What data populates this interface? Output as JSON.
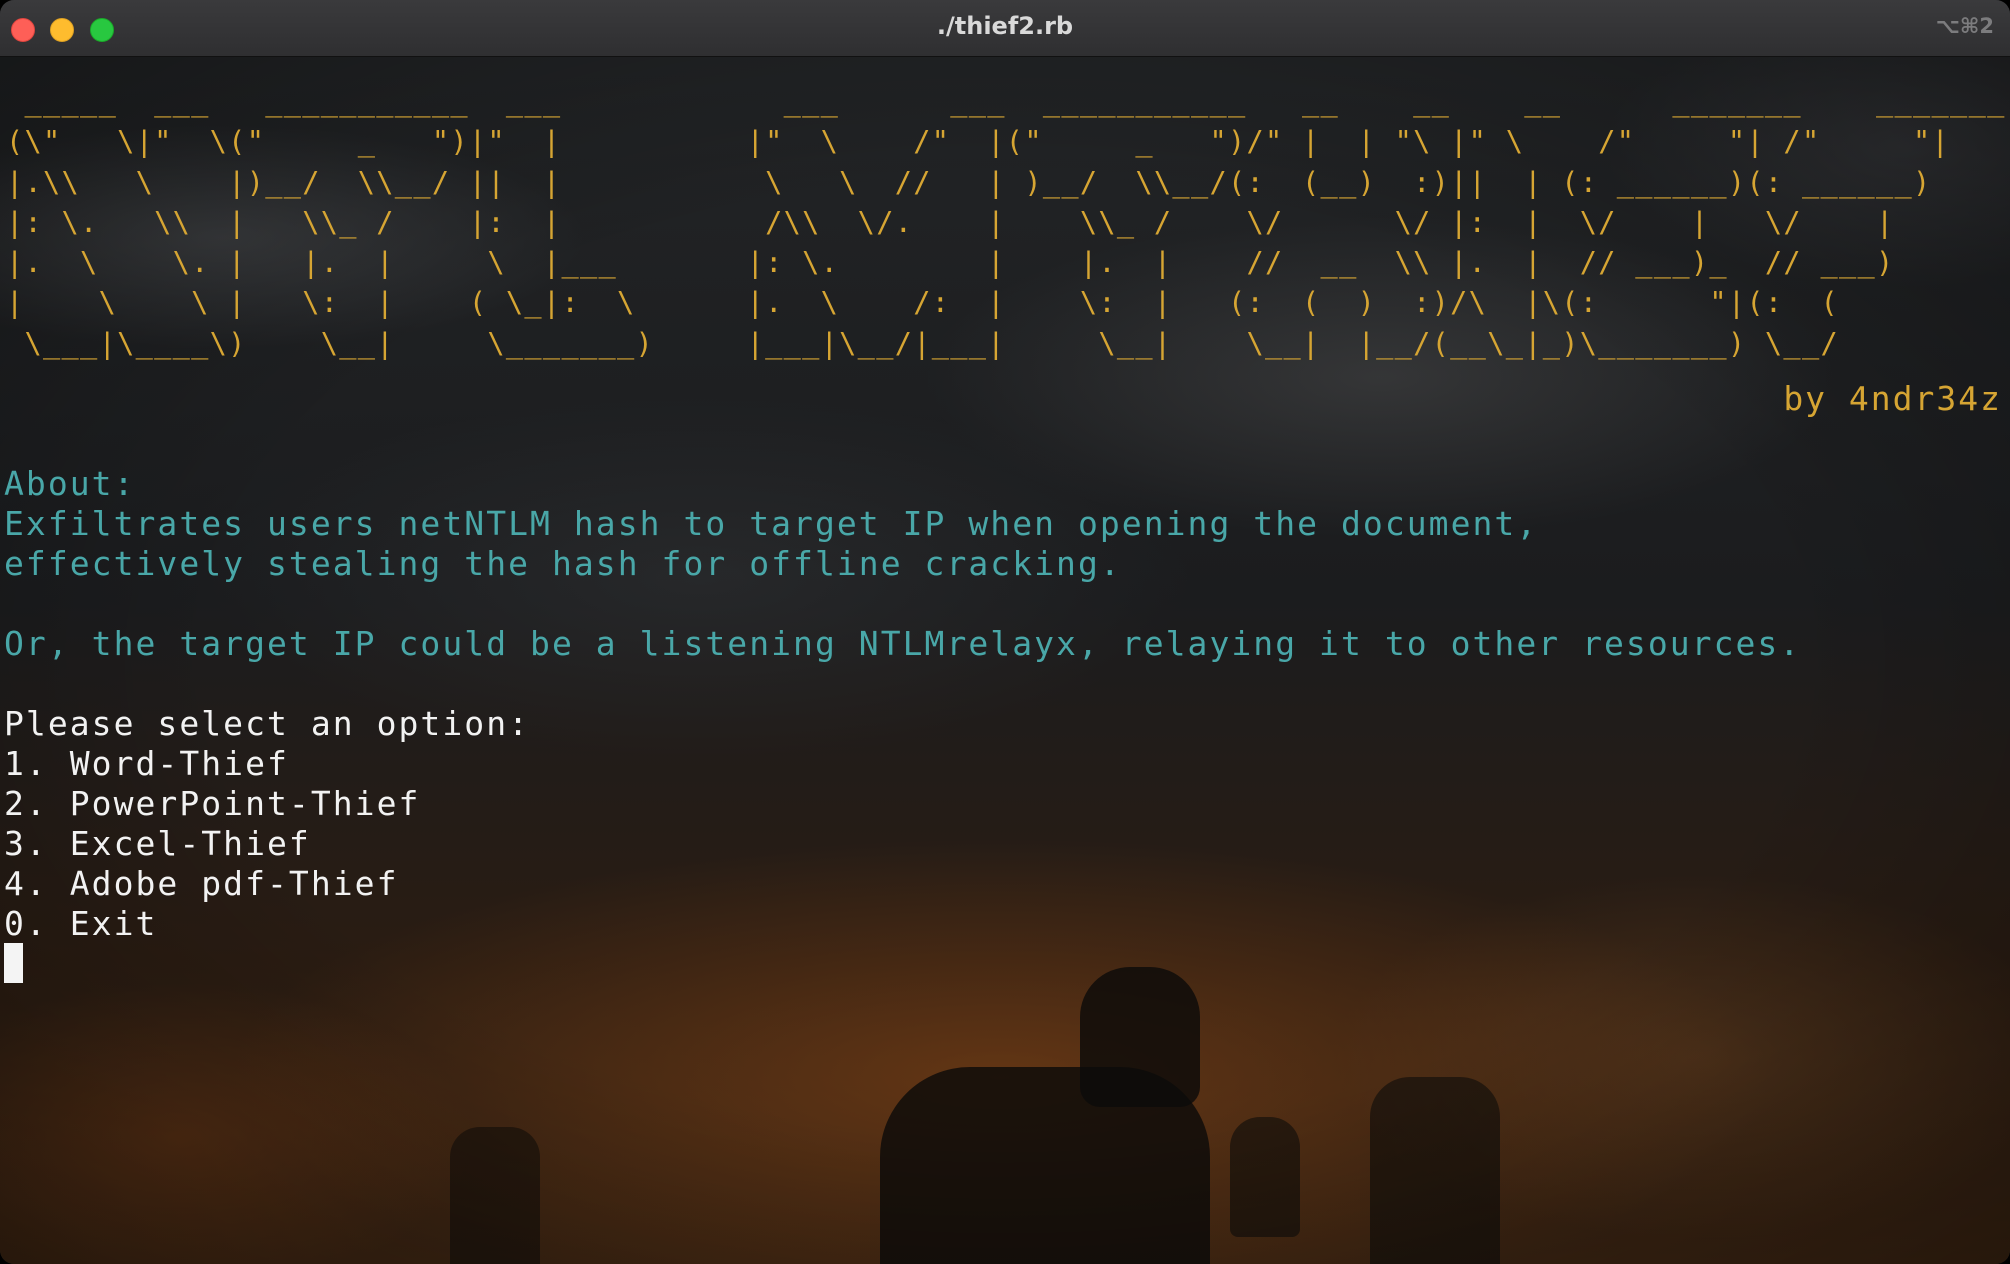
{
  "window": {
    "title": "./thief2.rb",
    "shortcut": "⌥⌘2"
  },
  "terminal": {
    "banner": " _____  ___   ___________  ___            ___      ___  ___________   __    __    __      _______    _______\n(\\\"   \\|\"  \\(\"     _   \")|\"  |          |\"  \\    /\"  |(\"     _   \")/\" |  | \"\\ |\" \\    /\"     \"| /\"     \"|\n|.\\\\   \\    |)__/  \\\\__/ ||  |           \\   \\  //   | )__/  \\\\__/(:  (__)  :)||  | (: ______)(: ______)\n|: \\.   \\\\  |   \\\\_ /    |:  |           /\\\\  \\/.    |    \\\\_ /    \\/      \\/ |:  |  \\/    |   \\/    |\n|.  \\    \\. |   |.  |     \\  |___       |: \\.        |    |.  |    //  __  \\\\ |.  |  // ___)_  // ___)\n|    \\    \\ |   \\:  |    ( \\_|:  \\      |.  \\    /:  |    \\:  |   (:  (  )  :)/\\  |\\(:      \"|(:  (\n \\___|\\____\\)    \\__|     \\_______)     |___|\\__/|___|     \\__|    \\__|  |__/(__\\_|_)\\_______) \\__/",
    "author": "by 4ndr34z",
    "about_heading": "About:",
    "about_line1": "Exfiltrates users netNTLM hash to target IP when opening the document,",
    "about_line2": "effectively stealing the hash for offline cracking.",
    "relay_note": "Or, the target IP could be a listening NTLMrelayx, relaying it to other resources.",
    "prompt": "Please select an option:",
    "options": [
      "1. Word-Thief",
      "2. PowerPoint-Thief",
      "3. Excel-Thief",
      "4. Adobe pdf-Thief",
      "0. Exit"
    ]
  },
  "colors": {
    "banner": "#d6a533",
    "about_text": "#49a7a8",
    "menu_text": "#f2f2f2"
  }
}
